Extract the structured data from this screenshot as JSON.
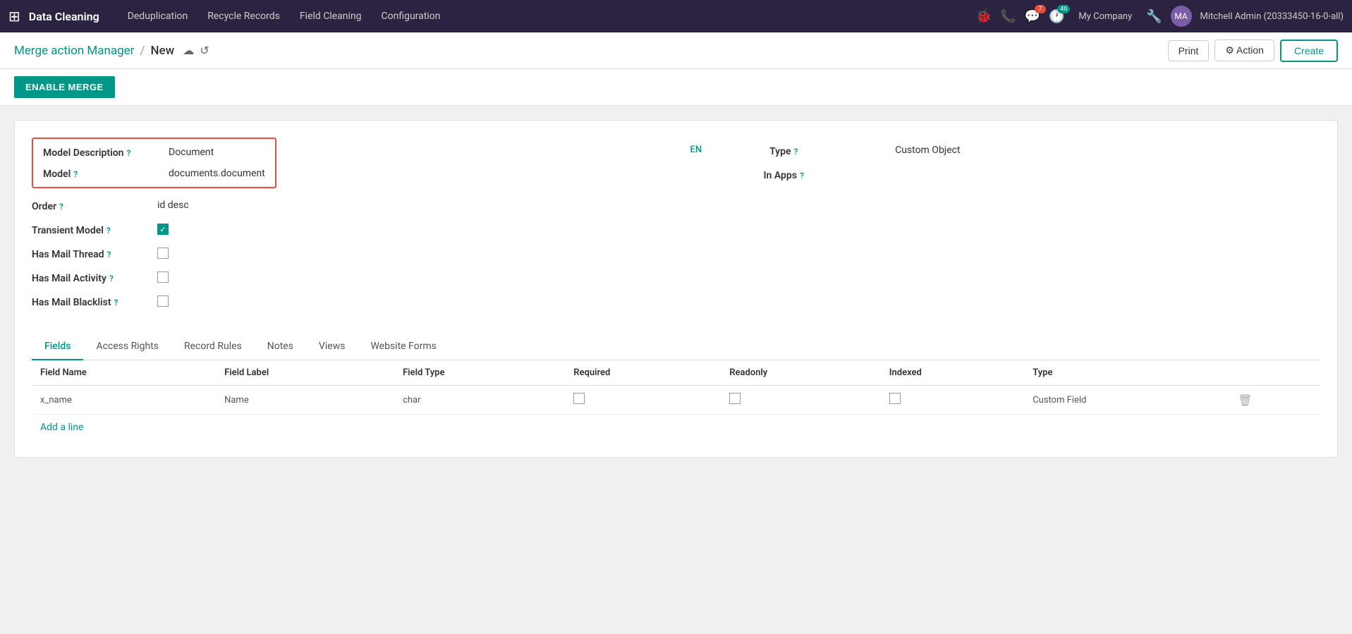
{
  "app": {
    "name": "Data Cleaning",
    "nav_links": [
      "Deduplication",
      "Recycle Records",
      "Field Cleaning",
      "Configuration"
    ]
  },
  "topnav": {
    "icons": {
      "bug": "🐞",
      "phone": "📞",
      "chat": "💬",
      "clock": "🕐"
    },
    "chat_badge": "7",
    "clock_badge": "46",
    "company": "My Company",
    "user": "Mitchell Admin (20333450-16-0-all)"
  },
  "breadcrumb": {
    "parent": "Merge action Manager",
    "separator": "/",
    "current": "New"
  },
  "toolbar": {
    "print_label": "Print",
    "action_label": "⚙ Action",
    "create_label": "Create"
  },
  "enable_merge_label": "ENABLE MERGE",
  "form": {
    "model_description_label": "Model Description",
    "model_description_value": "Document",
    "model_label": "Model",
    "model_value": "documents.document",
    "order_label": "Order",
    "order_value": "id desc",
    "transient_model_label": "Transient Model",
    "transient_model_checked": true,
    "has_mail_thread_label": "Has Mail Thread",
    "has_mail_thread_checked": false,
    "has_mail_activity_label": "Has Mail Activity",
    "has_mail_activity_checked": false,
    "has_mail_blacklist_label": "Has Mail Blacklist",
    "has_mail_blacklist_checked": false,
    "lang_badge": "EN",
    "type_label": "Type",
    "type_value": "Custom Object",
    "in_apps_label": "In Apps",
    "in_apps_value": ""
  },
  "tabs": [
    {
      "id": "fields",
      "label": "Fields",
      "active": true
    },
    {
      "id": "access-rights",
      "label": "Access Rights",
      "active": false
    },
    {
      "id": "record-rules",
      "label": "Record Rules",
      "active": false
    },
    {
      "id": "notes",
      "label": "Notes",
      "active": false
    },
    {
      "id": "views",
      "label": "Views",
      "active": false
    },
    {
      "id": "website-forms",
      "label": "Website Forms",
      "active": false
    }
  ],
  "table": {
    "columns": [
      "Field Name",
      "Field Label",
      "Field Type",
      "Required",
      "Readonly",
      "Indexed",
      "Type"
    ],
    "rows": [
      {
        "field_name": "x_name",
        "field_label": "Name",
        "field_type": "char",
        "required": false,
        "readonly": false,
        "indexed": false,
        "type": "Custom Field"
      }
    ],
    "add_line_label": "Add a line"
  }
}
